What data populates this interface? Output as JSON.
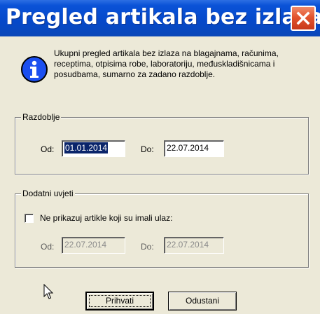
{
  "window": {
    "title": "Pregled artikala bez izlaza"
  },
  "info": {
    "icon": "info-icon",
    "text": "Ukupni pregled artikala bez izlaza na blagajnama, računima, receptima, otpisima robe, laboratoriju, međuskladišnicama i posudbama, sumarno za zadano razdoblje."
  },
  "period": {
    "group_label": "Razdoblje",
    "from_label": "Od:",
    "from_value": "01.01.2014",
    "to_label": "Do:",
    "to_value": "22.07.2014"
  },
  "conditions": {
    "group_label": "Dodatni uvjeti",
    "checkbox_label": "Ne prikazuj artikle koji su imali ulaz:",
    "checkbox_checked": false,
    "from_label": "Od:",
    "from_value": "22.07.2014",
    "to_label": "Do:",
    "to_value": "22.07.2014"
  },
  "buttons": {
    "accept_label": "Prihvati",
    "cancel_label": "Odustani"
  },
  "colors": {
    "titlebar": "#0548c9",
    "close": "#e2542e",
    "selection": "#0a246a",
    "dialog_bg": "#ece9d8"
  }
}
